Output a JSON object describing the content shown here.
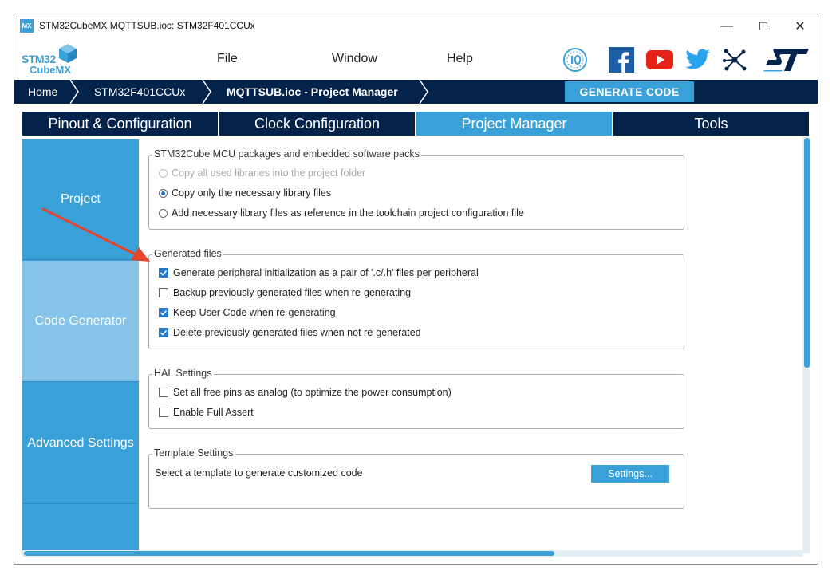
{
  "window": {
    "app_icon": "MX",
    "title": "STM32CubeMX MQTTSUB.ioc: STM32F401CCUx",
    "controls": {
      "minimize": "—",
      "maximize": "☐",
      "close": "✕"
    }
  },
  "menubar": {
    "logo_line1": "STM32",
    "logo_line2": "CubeMX",
    "items": [
      "File",
      "Window",
      "Help"
    ],
    "icons": [
      "anniversary-badge-icon",
      "facebook-icon",
      "youtube-icon",
      "twitter-icon",
      "network-icon",
      "st-logo-icon"
    ]
  },
  "breadcrumb": {
    "items": [
      "Home",
      "STM32F401CCUx",
      "MQTTSUB.ioc - Project Manager"
    ],
    "generate_label": "GENERATE CODE"
  },
  "tabs": [
    {
      "label": "Pinout & Configuration",
      "active": false
    },
    {
      "label": "Clock Configuration",
      "active": false
    },
    {
      "label": "Project Manager",
      "active": true
    },
    {
      "label": "Tools",
      "active": false
    }
  ],
  "sidenav": {
    "items": [
      {
        "label": "Project",
        "active": false
      },
      {
        "label": "Code Generator",
        "active": true
      },
      {
        "label": "Advanced Settings",
        "active": false
      }
    ]
  },
  "packages": {
    "title": "STM32Cube MCU packages and embedded software packs",
    "options": [
      {
        "label": "Copy all used libraries into the project folder",
        "selected": false,
        "disabled": true
      },
      {
        "label": "Copy only the necessary library files",
        "selected": true,
        "disabled": false
      },
      {
        "label": "Add necessary library files as reference in the toolchain project configuration file",
        "selected": false,
        "disabled": false
      }
    ]
  },
  "generated_files": {
    "title": "Generated files",
    "options": [
      {
        "label": "Generate peripheral initialization as a pair of '.c/.h' files per peripheral",
        "checked": true
      },
      {
        "label": "Backup previously generated files when re-generating",
        "checked": false
      },
      {
        "label": "Keep User Code when re-generating",
        "checked": true
      },
      {
        "label": "Delete previously generated files when not re-generated",
        "checked": true
      }
    ]
  },
  "hal_settings": {
    "title": "HAL Settings",
    "options": [
      {
        "label": "Set all free pins as analog (to optimize the power consumption)",
        "checked": false
      },
      {
        "label": "Enable Full Assert",
        "checked": false
      }
    ]
  },
  "template_settings": {
    "title": "Template Settings",
    "description": "Select a template to generate customized code",
    "button_label": "Settings..."
  },
  "colors": {
    "navy": "#03234b",
    "accent": "#3aa0d8",
    "nav_active": "#85c4e8",
    "annotation_arrow": "#e8412c"
  }
}
